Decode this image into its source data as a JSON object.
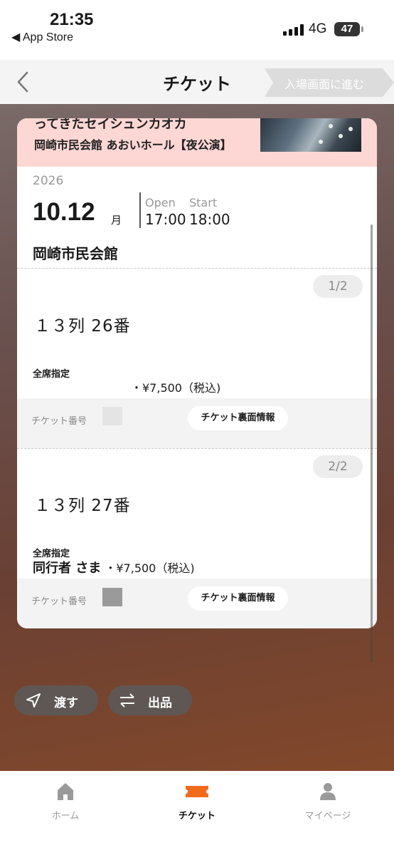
{
  "status_bar": {
    "time": "21:35",
    "back_app": "◀ App Store",
    "network": "4G",
    "battery": "47"
  },
  "navbar": {
    "title": "チケット",
    "entry_button": "入場画面に進む"
  },
  "ticket": {
    "banner": {
      "line1": "ってきたセイシュンカオカ",
      "line2": "岡崎市民会館 あおいホール【夜公演】"
    },
    "year": "2026",
    "date": "10.12",
    "month_suffix": "月",
    "open_label": "Open",
    "start_label": "Start",
    "open_time": "17:00",
    "start_time": "18:00",
    "venue": "岡崎市民会館",
    "seats": [
      {
        "pager": "1/2",
        "seat": "１３列 26番",
        "seat_type": "全席指定",
        "holder": "",
        "price": "・¥7,500（税込)",
        "ticket_number_label": "チケット番号",
        "back_info_button": "チケット裏面情報"
      },
      {
        "pager": "2/2",
        "seat": "１３列 27番",
        "seat_type": "全席指定",
        "holder": "同行者 さま",
        "price": " ・¥7,500（税込)",
        "ticket_number_label": "チケット番号",
        "back_info_button": "チケット裏面情報"
      }
    ]
  },
  "actions": {
    "transfer": "渡す",
    "list": "出品"
  },
  "tabbar": {
    "home": "ホーム",
    "ticket": "チケット",
    "mypage": "マイページ"
  },
  "colors": {
    "accent": "#f26b1d",
    "banner_bg": "#fcd7d4",
    "button_bg": "#5f5754"
  }
}
